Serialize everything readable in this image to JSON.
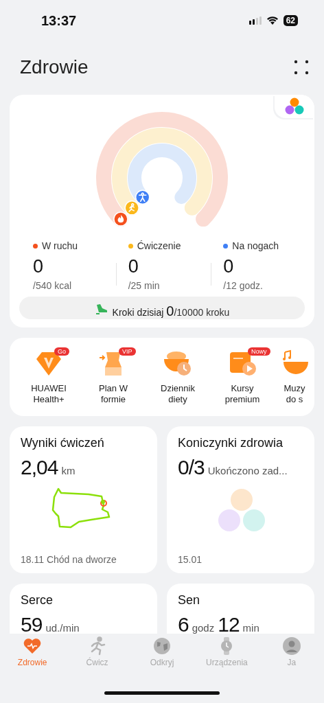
{
  "status_bar": {
    "time": "13:37",
    "battery": "62"
  },
  "header": {
    "title": "Zdrowie"
  },
  "activity": {
    "rings": [
      {
        "name": "W ruchu",
        "color": "#f4511e",
        "value": "0",
        "goal": "/540 kcal",
        "kind": "flame"
      },
      {
        "name": "Ćwiczenie",
        "color": "#fbb81c",
        "value": "0",
        "goal": "/25 min",
        "kind": "runner"
      },
      {
        "name": "Na nogach",
        "color": "#3f7ff5",
        "value": "0",
        "goal": "/12 godz.",
        "kind": "standing"
      }
    ],
    "steps": {
      "label": "Kroki dzisiaj",
      "value": "0",
      "goal": "/10000 kroku"
    }
  },
  "services": [
    {
      "label": "HUAWEI Health+",
      "badge": "Go",
      "kind": "diamond"
    },
    {
      "label": "Plan W formie",
      "badge": "VIP",
      "kind": "waist"
    },
    {
      "label": "Dziennik diety",
      "kind": "bowl"
    },
    {
      "label": "Kursy premium",
      "badge": "Nowy",
      "kind": "video"
    },
    {
      "label": "Muzy do s",
      "kind": "music"
    }
  ],
  "cards": [
    {
      "title": "Wyniki ćwiczeń",
      "value": "2,04",
      "unit": "km",
      "footer": "18.11 Chód na dworze",
      "kind": "route"
    },
    {
      "title": "Koniczynki zdrowia",
      "value": "0/3",
      "unit": "Ukończono zad...",
      "footer": "15.01",
      "kind": "clover"
    },
    {
      "title": "Serce",
      "value": "59",
      "unit": "ud./min",
      "kind": "plain"
    },
    {
      "title": "Sen",
      "value": "6",
      "unit": "godz",
      "value_2": "12",
      "unit_2": "min",
      "kind": "plain"
    }
  ],
  "tabs": [
    {
      "label": "Zdrowie",
      "selected": true,
      "kind": "heart"
    },
    {
      "label": "Ćwicz",
      "selected": false,
      "kind": "runner"
    },
    {
      "label": "Odkryj",
      "selected": false,
      "kind": "globe"
    },
    {
      "label": "Urządzenia",
      "selected": false,
      "kind": "watch"
    },
    {
      "label": "Ja",
      "selected": false,
      "kind": "person"
    }
  ]
}
